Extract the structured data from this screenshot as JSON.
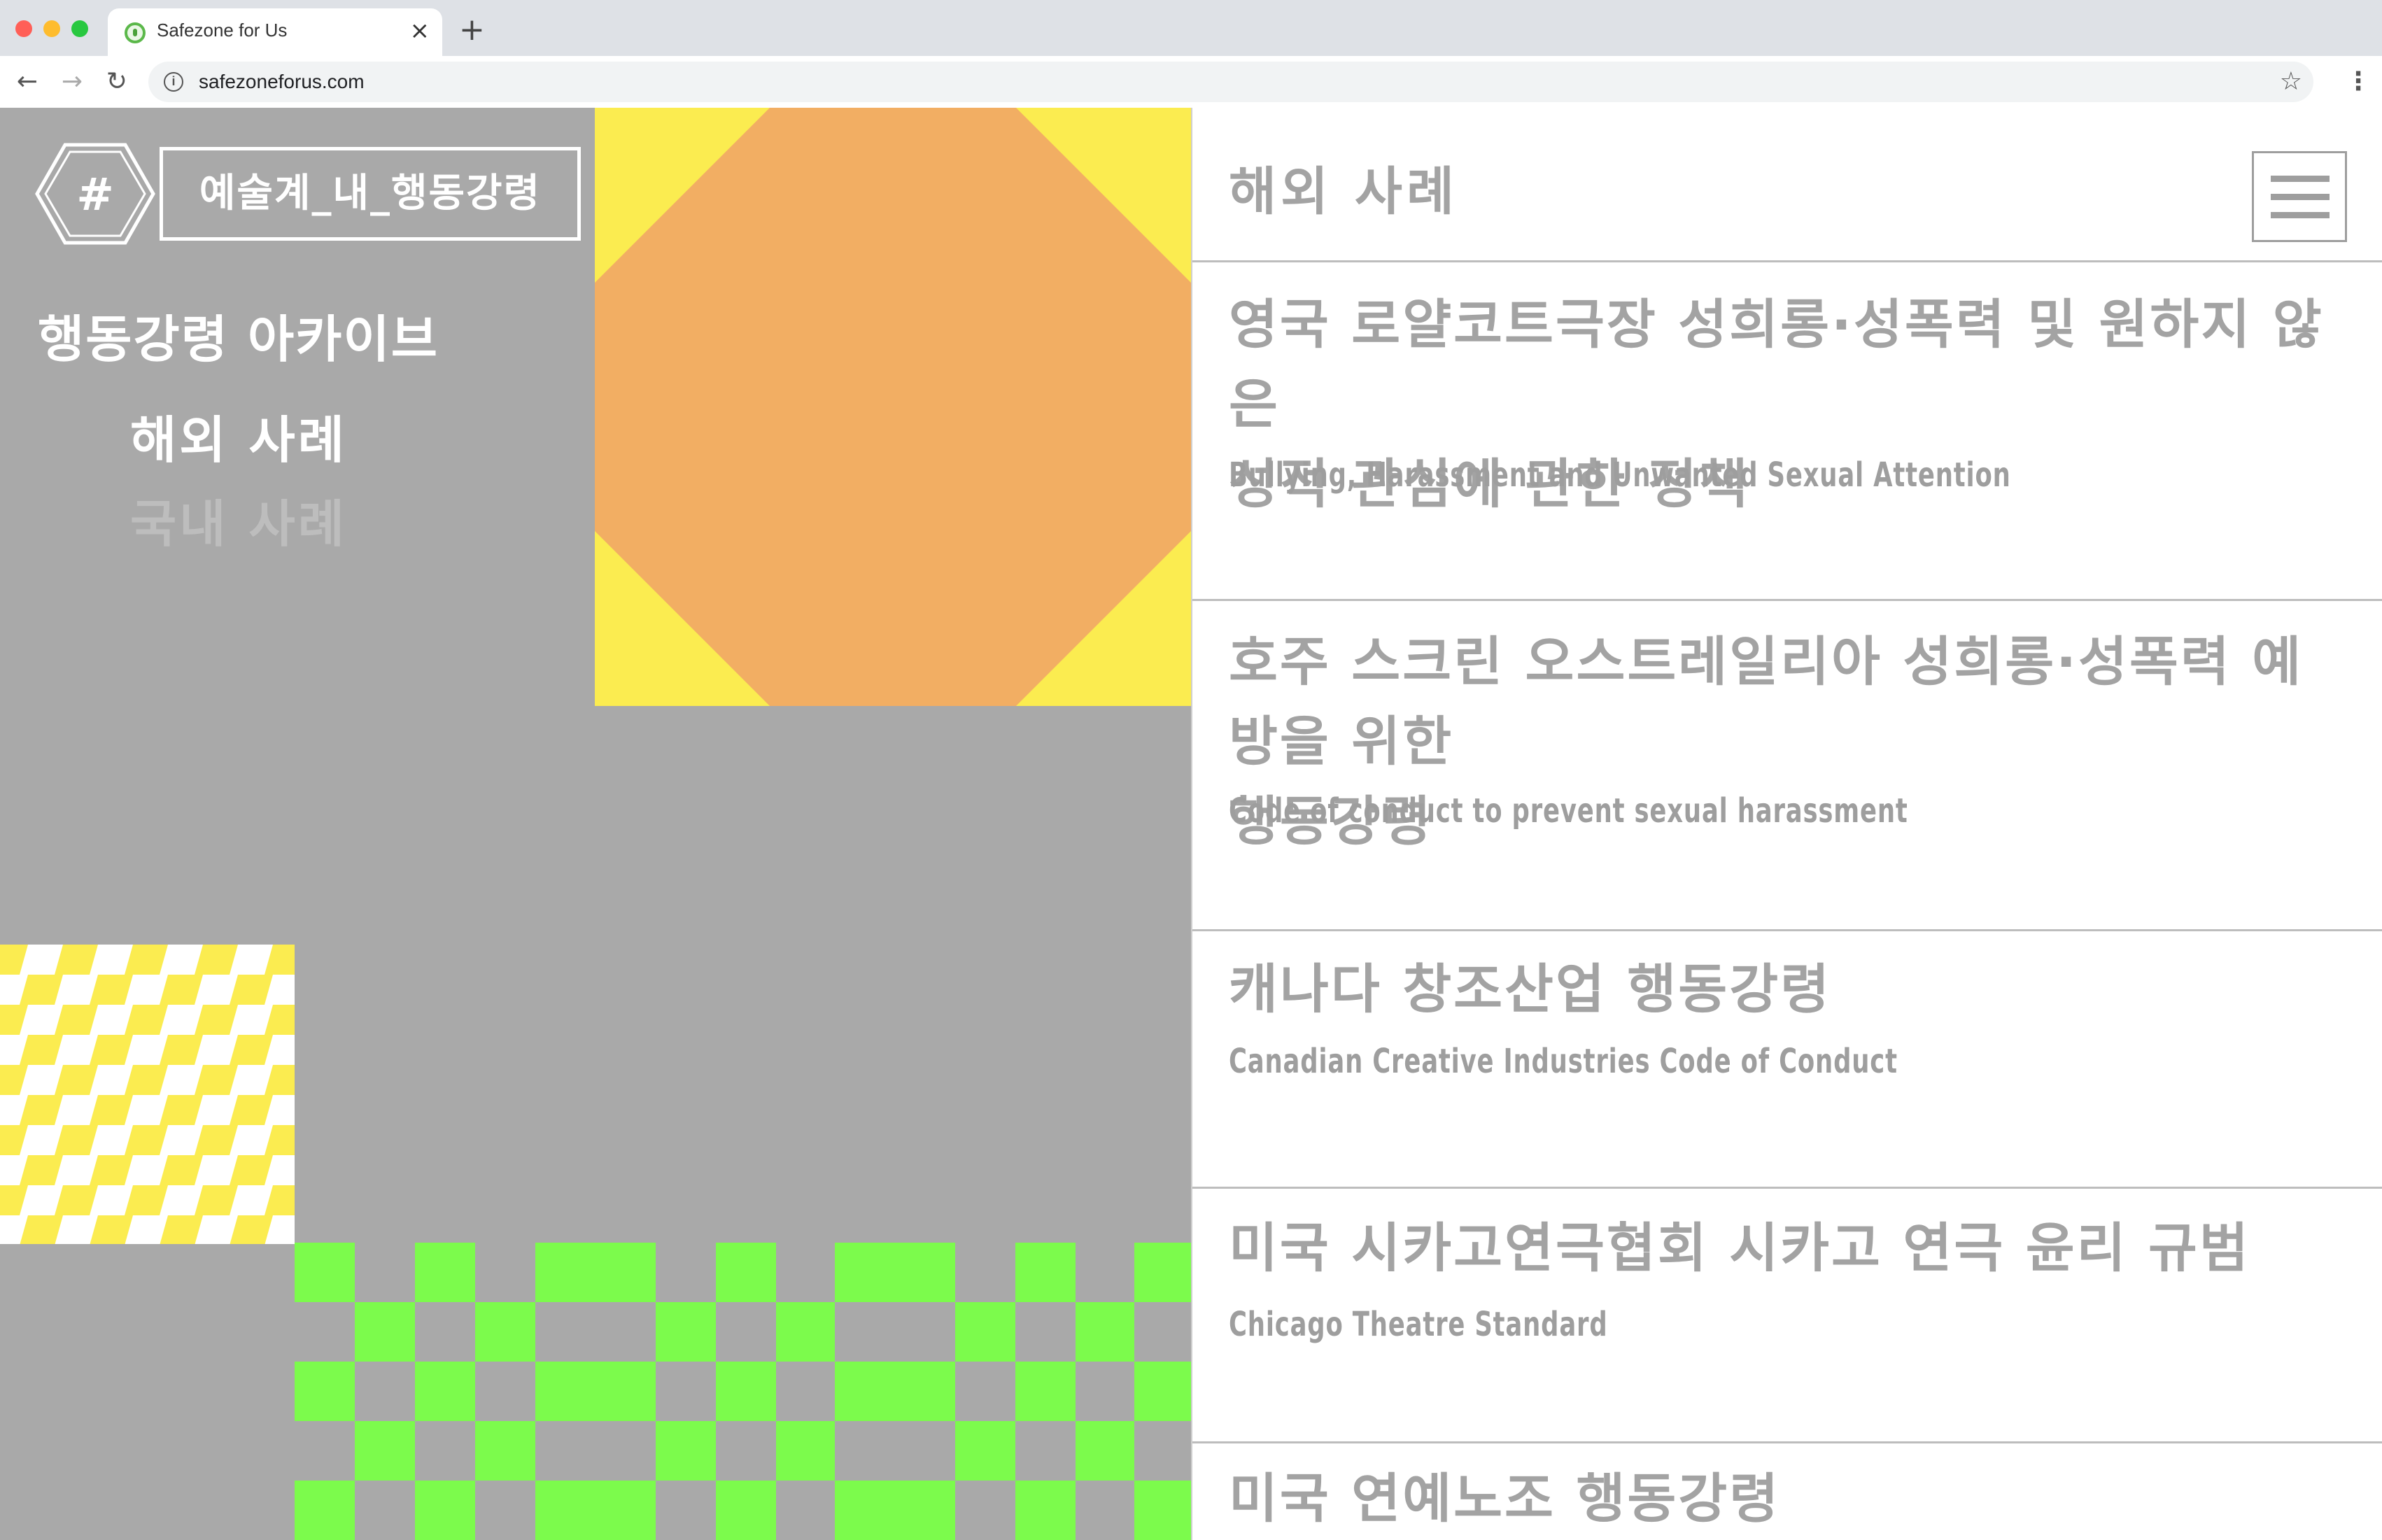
{
  "browser": {
    "tab_title": "Safezone for Us",
    "tab_close": "×",
    "new_tab": "+",
    "url": "safezoneforus.com",
    "back": "←",
    "forward": "→",
    "reload": "↻",
    "star": "☆",
    "menu": "⋮",
    "info": "i"
  },
  "sidebar": {
    "logo_symbol": "#",
    "logo_text": "예술계_내_행동강령",
    "archive_title": "행동강령 아카이브",
    "nav": [
      {
        "label": "해외 사례",
        "active": true
      },
      {
        "label": "국내 사례",
        "active": false
      }
    ]
  },
  "main": {
    "section_title": "해외 사례",
    "cases": [
      {
        "title_ko_line1": "영국 로얄코트극장 성희롱·성폭력 및 원하지 않은",
        "title_ko_line2": "성적 관심에 관한 정책",
        "title_en": "Bullying, Harassment and Unwanted Sexual Attention"
      },
      {
        "title_ko_line1": "호주 스크린 오스트레일리아 성희롱·성폭력 예방을 위한",
        "title_ko_line2": "행동강령",
        "title_en": "Code of conduct to prevent sexual harassment"
      },
      {
        "title_ko_line1": "캐나다 창조산업 행동강령",
        "title_en": "Canadian Creative Industries Code of Conduct"
      },
      {
        "title_ko_line1": "미국 시카고연극협회 시카고 연극 윤리 규범",
        "title_en": "Chicago Theatre Standard"
      },
      {
        "title_ko_line1": "미국 연예노조 행동강령"
      }
    ]
  },
  "colors": {
    "panel_gray": "#a9a9a9",
    "yellow": "#fbec50",
    "orange": "#f2ae63",
    "green": "#7cfb4c",
    "text_gray": "#a3a3a3"
  }
}
